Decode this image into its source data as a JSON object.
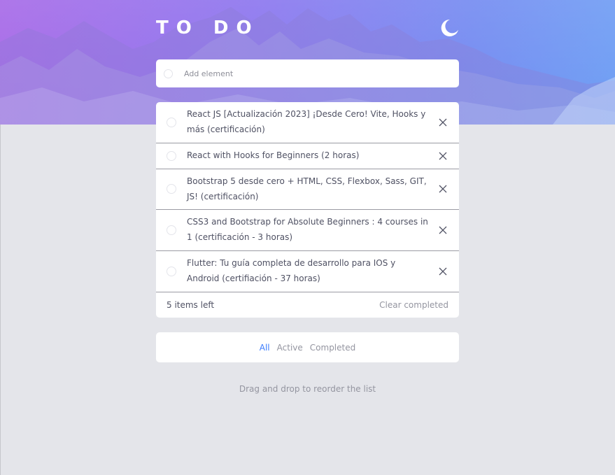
{
  "header": {
    "title": "TO DO",
    "theme_icon": "moon-icon"
  },
  "add": {
    "placeholder": "Add element",
    "icon": "circle-check-icon"
  },
  "todos": [
    {
      "text": "React JS [Actualización 2023] ¡Desde Cero! Vite, Hooks y más (certificación)",
      "completed": false
    },
    {
      "text": "React with Hooks for Beginners (2 horas)",
      "completed": false
    },
    {
      "text": "Bootstrap 5 desde cero + HTML, CSS, Flexbox, Sass, GIT, JS! (certificación)",
      "completed": false
    },
    {
      "text": "CSS3 and Bootstrap for Absolute Beginners : 4 courses in 1 (certificación - 3 horas)",
      "completed": false
    },
    {
      "text": "Flutter: Tu guía completa de desarrollo para IOS y Android (certifiación - 37 horas)",
      "completed": false
    }
  ],
  "footer": {
    "items_left": "5 items left",
    "clear_completed": "Clear completed"
  },
  "filters": [
    {
      "label": "All",
      "active": true
    },
    {
      "label": "Active",
      "active": false
    },
    {
      "label": "Completed",
      "active": false
    }
  ],
  "hint": "Drag and drop to reorder the list",
  "colors": {
    "accent": "#3a7bfd",
    "background": "#e4e5ea",
    "text": "#4f5163",
    "muted": "#9495a0"
  }
}
